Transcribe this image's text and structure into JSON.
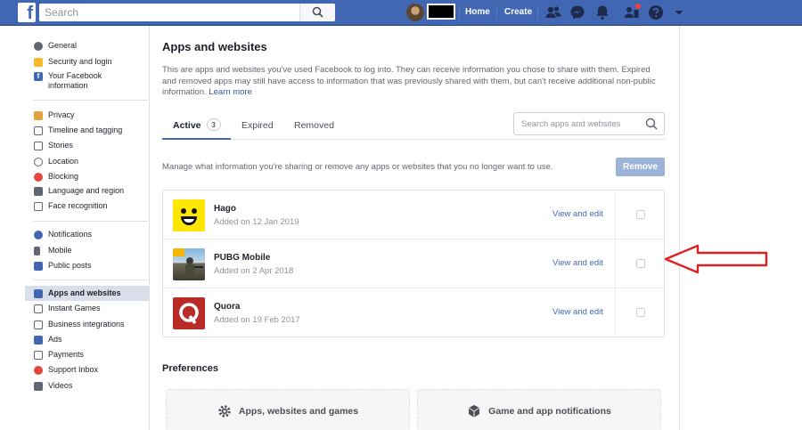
{
  "topbar": {
    "logo": "f",
    "search_placeholder": "Search",
    "nav": {
      "home": "Home",
      "create": "Create"
    },
    "icons": [
      "search-icon",
      "friend-requests-icon",
      "messenger-icon",
      "notifications-icon",
      "groups-icon",
      "help-icon",
      "chevron-down-icon"
    ]
  },
  "sidebar": {
    "group1": [
      {
        "label": "General",
        "icon": "gear-icon",
        "color": "#606770"
      },
      {
        "label": "Security and login",
        "icon": "shield-icon",
        "color": "#f7b928"
      },
      {
        "label": "Your Facebook information",
        "icon": "facebook-icon",
        "color": "#4267b2"
      }
    ],
    "group2": [
      {
        "label": "Privacy",
        "icon": "lock-icon",
        "color": "#e4a33a"
      },
      {
        "label": "Timeline and tagging",
        "icon": "timeline-icon",
        "color": "#606770"
      },
      {
        "label": "Stories",
        "icon": "book-icon",
        "color": "#606770"
      },
      {
        "label": "Location",
        "icon": "location-icon",
        "color": "#606770"
      },
      {
        "label": "Blocking",
        "icon": "blocking-icon",
        "color": "#e0483e"
      },
      {
        "label": "Language and region",
        "icon": "language-icon",
        "color": "#606770"
      },
      {
        "label": "Face recognition",
        "icon": "face-icon",
        "color": "#606770"
      }
    ],
    "group3": [
      {
        "label": "Notifications",
        "icon": "globe-icon",
        "color": "#4267b2"
      },
      {
        "label": "Mobile",
        "icon": "mobile-icon",
        "color": "#606770"
      },
      {
        "label": "Public posts",
        "icon": "rss-icon",
        "color": "#4267b2"
      }
    ],
    "group4": [
      {
        "label": "Apps and websites",
        "icon": "apps-icon",
        "color": "#4267b2",
        "active": true
      },
      {
        "label": "Instant Games",
        "icon": "games-icon",
        "color": "#606770"
      },
      {
        "label": "Business integrations",
        "icon": "business-icon",
        "color": "#606770"
      },
      {
        "label": "Ads",
        "icon": "ads-icon",
        "color": "#4267b2"
      },
      {
        "label": "Payments",
        "icon": "payments-icon",
        "color": "#606770"
      },
      {
        "label": "Support Inbox",
        "icon": "support-icon",
        "color": "#e0483e"
      },
      {
        "label": "Videos",
        "icon": "videos-icon",
        "color": "#606770"
      }
    ]
  },
  "main": {
    "title": "Apps and websites",
    "intro": "This are apps and websites you've used Facebook to log into. They can receive information you chose to share with them. Expired and removed apps may still have access to information that was previously shared with them, but can't receive additional non-public information.",
    "learn_more": "Learn more",
    "tabs": [
      {
        "label": "Active",
        "count": "3"
      },
      {
        "label": "Expired"
      },
      {
        "label": "Removed"
      }
    ],
    "tab_search_placeholder": "Search apps and websites",
    "manage_text": "Manage what information you're sharing or remove any apps or websites that you no longer want to use.",
    "remove_label": "Remove",
    "apps": [
      {
        "name": "Hago",
        "added": "Added on 12 Jan 2019",
        "action": "View and edit",
        "icon": "hago-icon"
      },
      {
        "name": "PUBG Mobile",
        "added": "Added on 2 Apr 2018",
        "action": "View and edit",
        "icon": "pubg-icon"
      },
      {
        "name": "Quora",
        "added": "Added on 19 Feb 2017",
        "action": "View and edit",
        "icon": "quora-icon"
      }
    ],
    "preferences_title": "Preferences",
    "preferences": [
      {
        "label": "Apps, websites and games",
        "icon": "gear-icon"
      },
      {
        "label": "Game and app notifications",
        "icon": "cube-icon"
      }
    ]
  },
  "colors": {
    "topbar": "#4267b2",
    "link": "#4267b2",
    "annotation_arrow": "#e02020"
  }
}
